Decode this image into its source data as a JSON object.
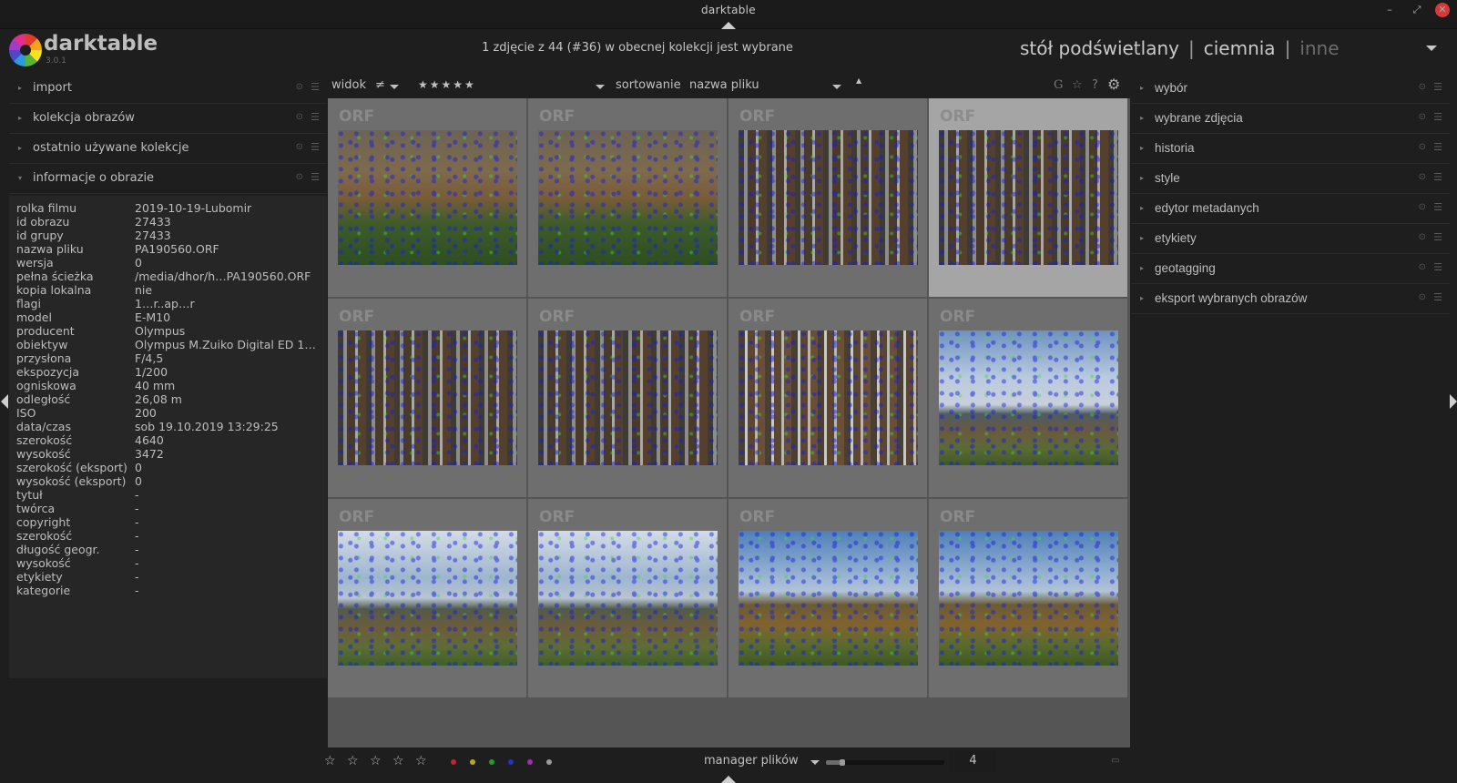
{
  "window": {
    "title": "darktable",
    "minimize_icon": "–",
    "maximize_icon": "⤢",
    "close_icon": "✕"
  },
  "header": {
    "app_name": "darktable",
    "version": "3.0.1",
    "collection_info": "1 zdjęcie z 44 (#36) w obecnej kolekcji jest wybrane",
    "views": {
      "lighttable": "stół podświetlany",
      "separator": "|",
      "darkroom": "ciemnia",
      "other": "inne"
    }
  },
  "left_panel": {
    "modules": [
      {
        "label": "import",
        "expanded": false
      },
      {
        "label": "kolekcja obrazów",
        "expanded": false
      },
      {
        "label": "ostatnio używane kolekcje",
        "expanded": false
      },
      {
        "label": "informacje o obrazie",
        "expanded": true
      }
    ],
    "metadata": [
      {
        "key": "rolka filmu",
        "value": "2019-10-19-Lubomir"
      },
      {
        "key": "id obrazu",
        "value": "27433"
      },
      {
        "key": "id grupy",
        "value": "27433"
      },
      {
        "key": "nazwa pliku",
        "value": "PA190560.ORF"
      },
      {
        "key": "wersja",
        "value": "0"
      },
      {
        "key": "pełna ścieżka",
        "value": " /media/dhor/h…PA190560.ORF"
      },
      {
        "key": "kopia lokalna",
        "value": "nie"
      },
      {
        "key": "flagi",
        "value": "1…r..ap…r"
      },
      {
        "key": "model",
        "value": "E-M10"
      },
      {
        "key": "producent",
        "value": "Olympus"
      },
      {
        "key": "obiektyw",
        "value": "Olympus M.Zuiko Digital ED 1…"
      },
      {
        "key": "przysłona",
        "value": "F/4,5"
      },
      {
        "key": "ekspozycja",
        "value": "1/200"
      },
      {
        "key": "ogniskowa",
        "value": "40 mm"
      },
      {
        "key": "odległość",
        "value": "26,08 m"
      },
      {
        "key": "ISO",
        "value": "200"
      },
      {
        "key": "data/czas",
        "value": "sob 19.10.2019 13:29:25"
      },
      {
        "key": "szerokość",
        "value": "4640"
      },
      {
        "key": "wysokość",
        "value": "3472"
      },
      {
        "key": "szerokość (eksport)",
        "value": "0"
      },
      {
        "key": "wysokość (eksport)",
        "value": "0"
      },
      {
        "key": "tytuł",
        "value": "-"
      },
      {
        "key": "twórca",
        "value": "-"
      },
      {
        "key": "copyright",
        "value": "-"
      },
      {
        "key": "szerokość",
        "value": "-"
      },
      {
        "key": "długość geogr.",
        "value": "-"
      },
      {
        "key": "wysokość",
        "value": "-"
      },
      {
        "key": "etykiety",
        "value": "-"
      },
      {
        "key": "kategorie",
        "value": "-"
      }
    ]
  },
  "right_panel": {
    "modules": [
      {
        "label": "wybór"
      },
      {
        "label": "wybrane zdjęcia"
      },
      {
        "label": "historia"
      },
      {
        "label": "style"
      },
      {
        "label": "edytor metadanych"
      },
      {
        "label": "etykiety"
      },
      {
        "label": "geotagging"
      },
      {
        "label": "eksport wybranych obrazów"
      }
    ]
  },
  "top_toolbar": {
    "view_label": "widok",
    "comparator": "≠",
    "rating_stars": "★★★★★",
    "sort_label": "sortowanie",
    "sort_value": "nazwa pliku",
    "sort_direction": "▲",
    "grouping": "G",
    "overlays": "☆",
    "help": "?",
    "preferences": "⚙"
  },
  "thumbnails": [
    {
      "ext": "ORF",
      "scene": "hut",
      "selected": false
    },
    {
      "ext": "ORF",
      "scene": "hut",
      "selected": false
    },
    {
      "ext": "ORF",
      "scene": "forest",
      "selected": false
    },
    {
      "ext": "ORF",
      "scene": "forest",
      "selected": true
    },
    {
      "ext": "ORF",
      "scene": "forest",
      "selected": false
    },
    {
      "ext": "ORF",
      "scene": "forest",
      "selected": false
    },
    {
      "ext": "ORF",
      "scene": "forest2",
      "selected": false
    },
    {
      "ext": "ORF",
      "scene": "landscape",
      "selected": false
    },
    {
      "ext": "ORF",
      "scene": "landscape2",
      "selected": false
    },
    {
      "ext": "ORF",
      "scene": "landscape2",
      "selected": false
    },
    {
      "ext": "ORF",
      "scene": "hills",
      "selected": false
    },
    {
      "ext": "ORF",
      "scene": "hills",
      "selected": false
    }
  ],
  "bottom_toolbar": {
    "star_icon": "☆",
    "colors": [
      "#c0262b",
      "#b5a914",
      "#1e9e2a",
      "#2433c4",
      "#9d2fb1",
      "#9a9a9a"
    ],
    "layout_label": "manager plików",
    "zoom_value": "4",
    "zoom_fraction": 0.14
  }
}
